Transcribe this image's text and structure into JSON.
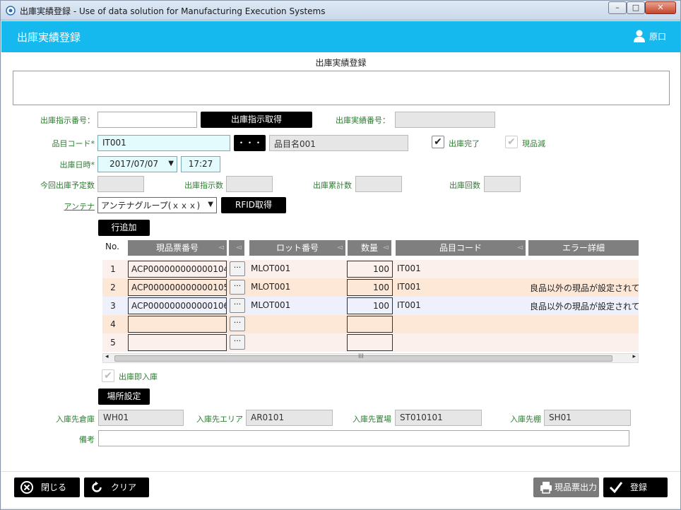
{
  "window": {
    "title": "出庫実績登録 - Use of data solution for Manufacturing Execution Systems",
    "min": "–",
    "max": "□",
    "close": "✕"
  },
  "header": {
    "title": "出庫実績登録",
    "user": "原口"
  },
  "section_title": "出庫実績登録",
  "form": {
    "order_no_label": "出庫指示番号：",
    "order_no_value": "",
    "get_order_btn": "出庫指示取得",
    "result_no_label": "出庫実績番号：",
    "result_no_value": "",
    "item_code_label": "品目コード*",
    "item_code_value": "IT001",
    "item_lookup_btn": "・・・",
    "item_name_value": "品目名001",
    "complete_label": "出庫完了",
    "complete_checked": true,
    "stock_reduce_label": "現品減",
    "stock_reduce_checked": true,
    "datetime_label": "出庫日時*",
    "date_value": "2017/07/07",
    "time_value": "17:27",
    "planned_qty_label": "今回出庫予定数",
    "instructed_qty_label": "出庫指示数",
    "cumulative_qty_label": "出庫累計数",
    "count_label": "出庫回数",
    "antenna_label": "アンテナ",
    "antenna_value": "アンテナグループ(ｘｘｘ)",
    "rfid_btn": "RFID取得",
    "add_row_btn": "行追加"
  },
  "grid": {
    "headers": {
      "no": "No.",
      "ticket": "現品票番号",
      "lot": "ロット番号",
      "qty": "数量",
      "item": "品目コード",
      "error": "エラー詳細"
    },
    "rows": [
      {
        "no": "1",
        "ticket": "ACP000000000000104",
        "lot": "MLOT001",
        "qty": "100",
        "item": "IT001",
        "error": ""
      },
      {
        "no": "2",
        "ticket": "ACP000000000000105",
        "lot": "MLOT001",
        "qty": "100",
        "item": "IT001",
        "error": "良品以外の現品が設定されてい"
      },
      {
        "no": "3",
        "ticket": "ACP000000000000106",
        "lot": "MLOT001",
        "qty": "100",
        "item": "IT001",
        "error": "良品以外の現品が設定されてい"
      },
      {
        "no": "4",
        "ticket": "",
        "lot": "",
        "qty": "",
        "item": "",
        "error": ""
      },
      {
        "no": "5",
        "ticket": "",
        "lot": "",
        "qty": "",
        "item": "",
        "error": ""
      }
    ],
    "dots": "···",
    "scroll_mid": "III"
  },
  "post": {
    "immediate_label": "出庫即入庫",
    "location_btn": "場所設定",
    "warehouse_label": "入庫先倉庫",
    "warehouse_value": "WH01",
    "area_label": "入庫先エリア",
    "area_value": "AR0101",
    "place_label": "入庫先置場",
    "place_value": "ST010101",
    "shelf_label": "入庫先棚",
    "shelf_value": "SH01",
    "note_label": "備考",
    "note_value": ""
  },
  "footer": {
    "close": "閉じる",
    "clear": "クリア",
    "print": "現品票出力",
    "register": "登録"
  },
  "colors": {
    "header": "#15b9ee",
    "row_pink": "#fcf0ec",
    "row_orange": "#fde8d8",
    "row_blue": "#eef0fb",
    "grid_header": "#7f7f7f"
  }
}
